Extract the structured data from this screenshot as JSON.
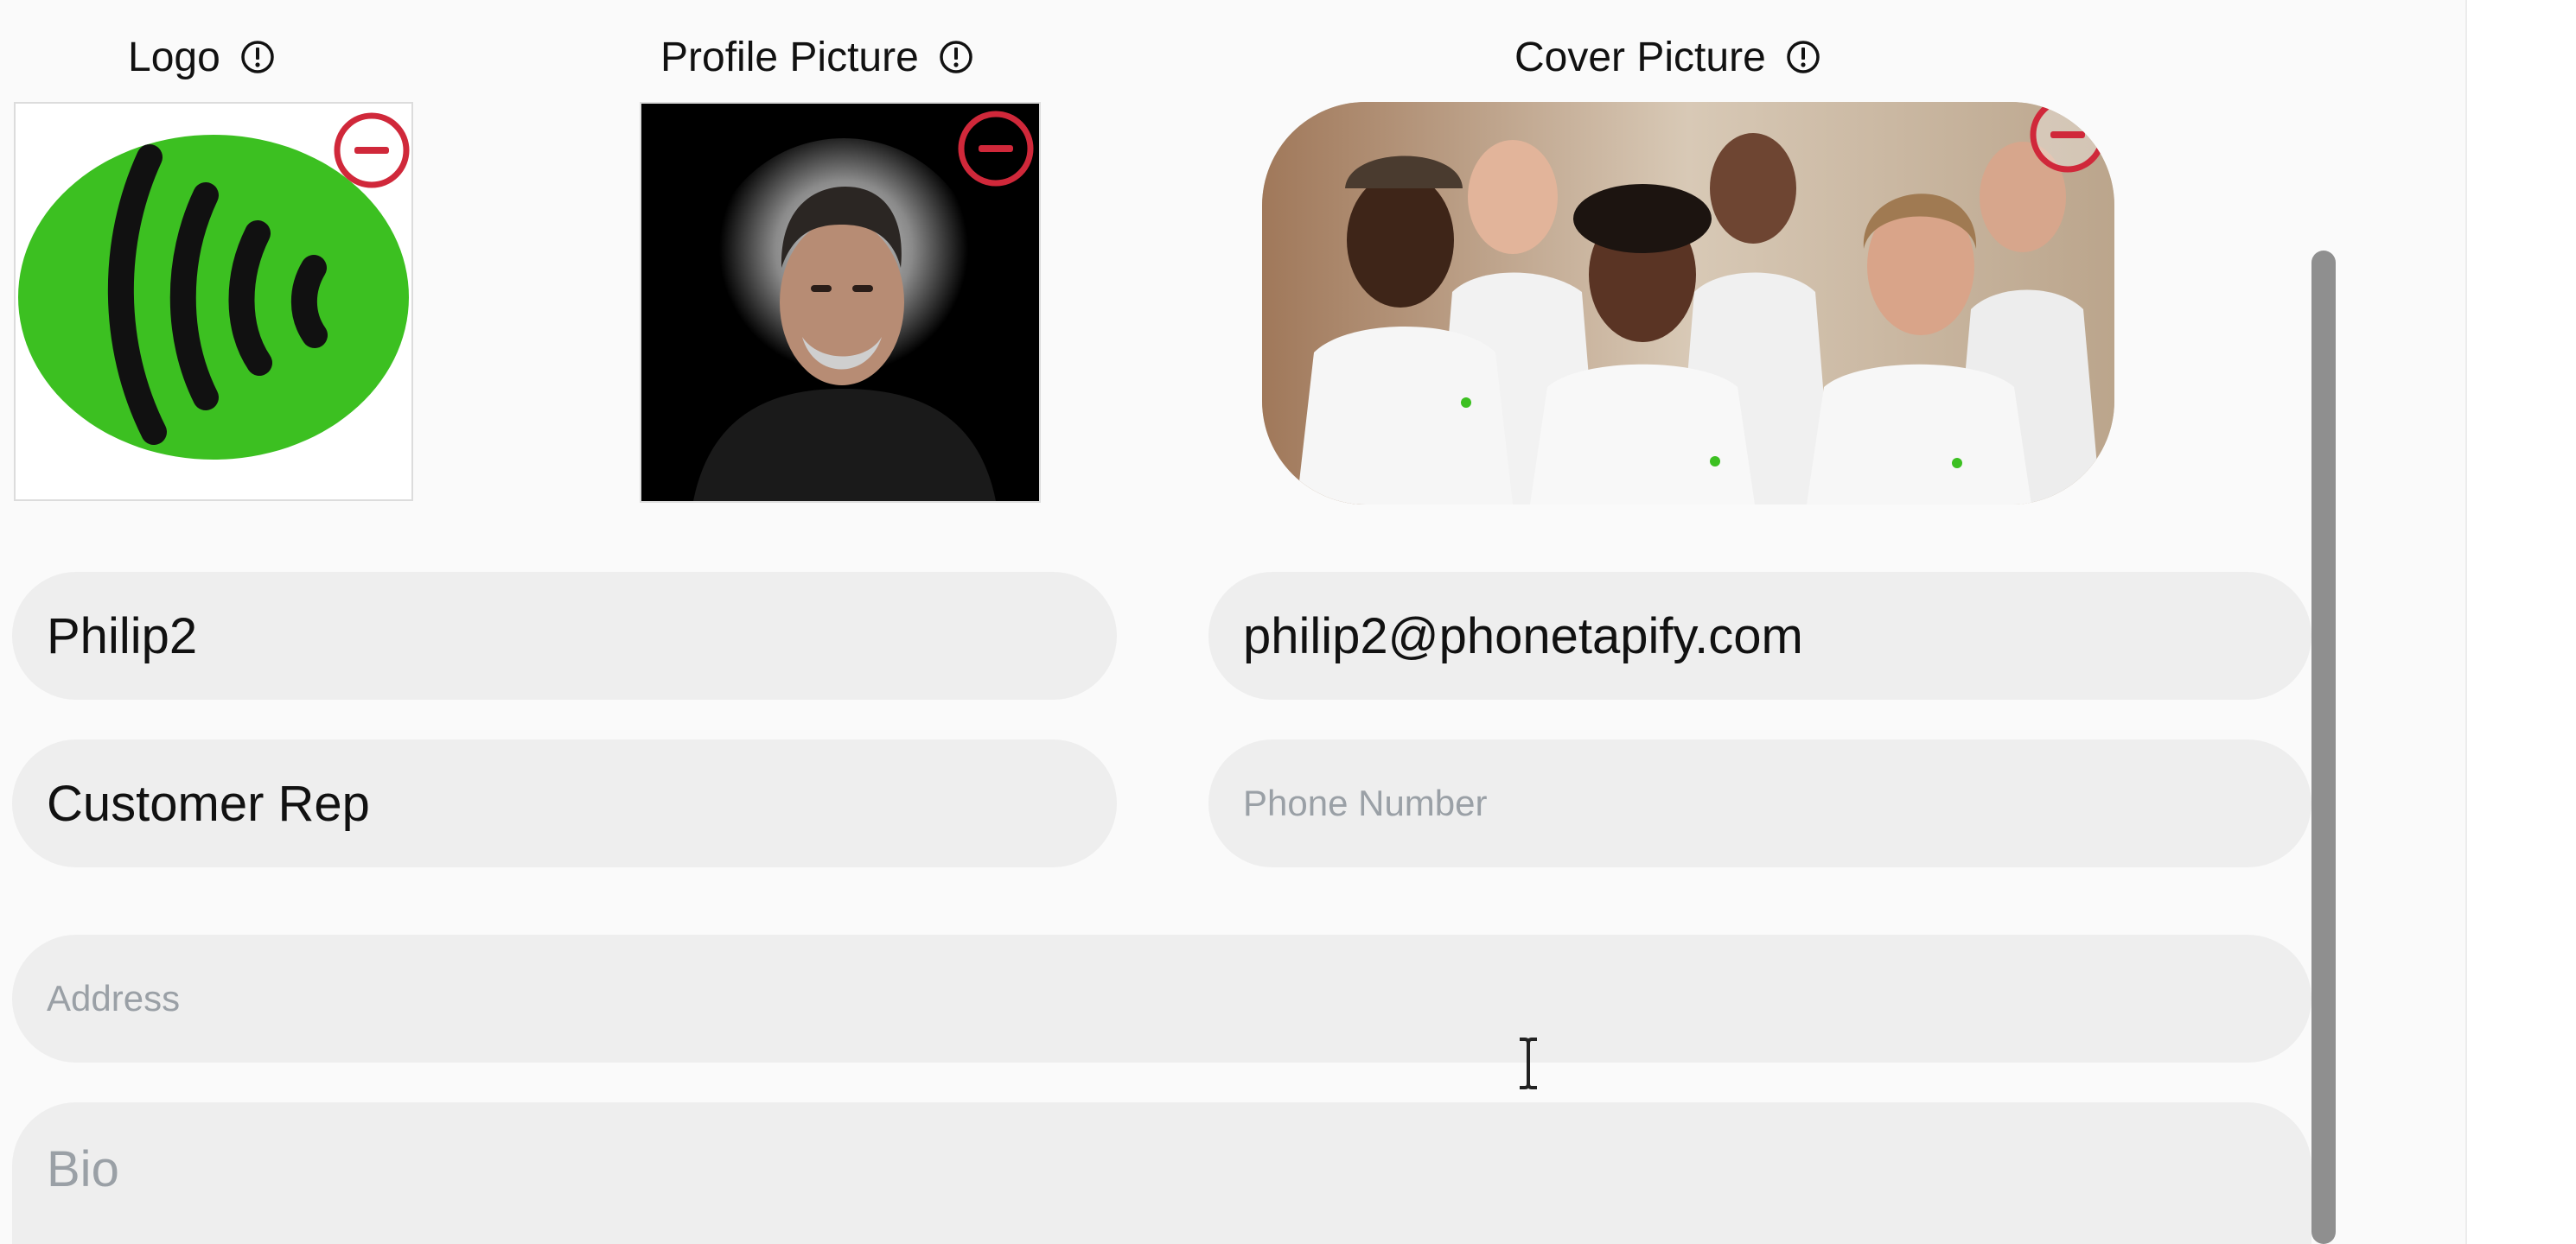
{
  "headings": {
    "logo": "Logo",
    "profile_picture": "Profile Picture",
    "cover_picture": "Cover Picture"
  },
  "icons": {
    "info": "info-circle-icon",
    "remove": "minus-circle-icon",
    "cursor": "text-cursor-icon"
  },
  "colors": {
    "remove_red": "#d0283a",
    "logo_green": "#3cc021",
    "field_bg": "#eeeeee",
    "scrollbar": "#8f8f8f"
  },
  "form": {
    "name": {
      "value": "Philip2",
      "placeholder": ""
    },
    "email": {
      "value": "philip2@phonetapify.com",
      "placeholder": ""
    },
    "job_title": {
      "value": "Customer Rep",
      "placeholder": ""
    },
    "phone": {
      "value": "",
      "placeholder": "Phone Number"
    },
    "address": {
      "value": "",
      "placeholder": "Address"
    },
    "bio": {
      "value": "",
      "placeholder": "Bio"
    }
  }
}
